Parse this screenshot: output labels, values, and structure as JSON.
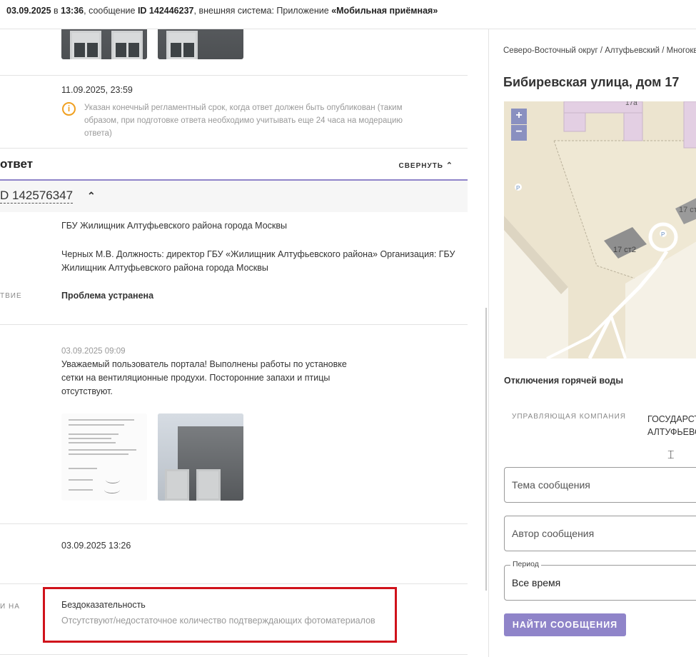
{
  "header": {
    "date": "03.09.2025",
    "at": " в ",
    "time": "13:36",
    "msg_prefix": ", сообщение ",
    "msg_id": "ID 142446237",
    "ext_prefix": ", внешняя система: Приложение ",
    "ext_name": "«Мобильная приёмная»"
  },
  "deadline": {
    "date": "11.09.2025, 23:59",
    "note_l1": "Указан конечный регламентный срок, когда ответ должен быть опубликован (таким",
    "note_l2": "образом, при подготовке ответа необходимо учитывать еще 24 часа на модерацию",
    "note_l3": "ответа)",
    "icon": "info-icon",
    "icon_color": "#f0a020"
  },
  "answer": {
    "title": "ответ",
    "collapse_label": "СВЕРНУТЬ",
    "id": "D 142576347",
    "org": "ГБУ Жилищник Алтуфьевского района города Москвы",
    "author_l1": "Черных М.В. Должность: директор ГБУ «Жилищник Алтуфьевского района» Организация: ГБУ",
    "author_l2": "Жилищник Алтуфьевского района города Москвы",
    "status_label": "ТВИЕ",
    "status": "Проблема устранена",
    "published": "03.09.2025 09:09",
    "text_l1": "Уважаемый пользователь портала! Выполнены работы по установке",
    "text_l2": "сетки на вентиляционные продухи. Посторонние запахи и птицы",
    "text_l3": "отсутствуют.",
    "date2": "03.09.2025 13:26",
    "reason_label": "И НА",
    "reason": "Бездоказательность",
    "reason_detail": "Отсутствуют/недостаточное количество подтверждающих фотоматериалов"
  },
  "sidebar": {
    "breadcrumb": "Северо-Восточный округ / Алтуфьевский / Многоквартирный дом",
    "address": "Бибиревская улица, дом 17",
    "map": {
      "zoom_in": "+",
      "zoom_out": "−",
      "labels": [
        "17а",
        "17 ст",
        "17 ст2"
      ],
      "parking": "P"
    },
    "hot_water": "Отключения горячей воды",
    "uk_label": "УПРАВЛЯЮЩАЯ КОМПАНИЯ",
    "uk_value_l1": "ГОСУДАРСТВЕННОЕ",
    "uk_value_l2": "АЛТУФЬЕВСКОГО",
    "topic_placeholder": "Тема сообщения",
    "author_placeholder": "Автор сообщения",
    "period_label": "Период",
    "period_value": "Все время",
    "find_button": "НАЙТИ СООБЩЕНИЯ"
  },
  "colors": {
    "accent": "#8f84c9",
    "highlight_border": "#d0121b"
  }
}
